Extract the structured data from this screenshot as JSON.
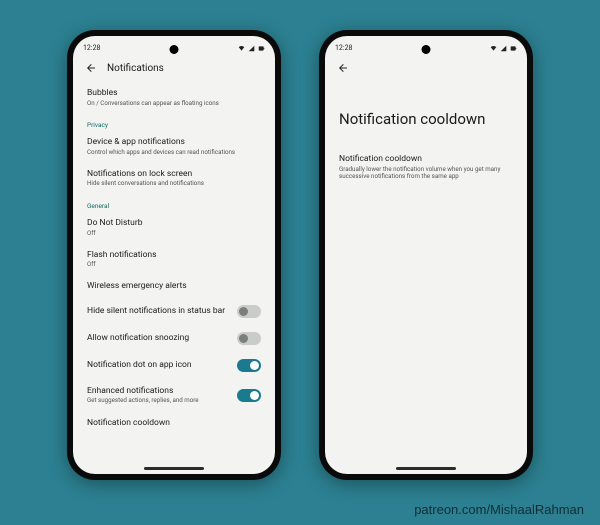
{
  "statusbar": {
    "time": "12:28"
  },
  "phone1": {
    "header_title": "Notifications",
    "bubbles": {
      "title": "Bubbles",
      "sub": "On / Conversations can appear as floating icons"
    },
    "section_privacy": "Privacy",
    "device_app": {
      "title": "Device & app notifications",
      "sub": "Control which apps and devices can read notifications"
    },
    "lock_screen": {
      "title": "Notifications on lock screen",
      "sub": "Hide silent conversations and notifications"
    },
    "section_general": "General",
    "dnd": {
      "title": "Do Not Disturb",
      "sub": "Off"
    },
    "flash": {
      "title": "Flash notifications",
      "sub": "Off"
    },
    "emergency": {
      "title": "Wireless emergency alerts"
    },
    "hide_silent": {
      "title": "Hide silent notifications in status bar"
    },
    "snoozing": {
      "title": "Allow notification snoozing"
    },
    "dot": {
      "title": "Notification dot on app icon"
    },
    "enhanced": {
      "title": "Enhanced notifications",
      "sub": "Get suggested actions, replies, and more"
    },
    "cooldown": {
      "title": "Notification cooldown"
    }
  },
  "phone2": {
    "big_title": "Notification cooldown",
    "item": {
      "title": "Notification cooldown",
      "sub": "Gradually lower the notification volume when you get many successive notifications from the same app"
    }
  },
  "credit": "patreon.com/MishaalRahman",
  "colors": {
    "accent": "#1a7b8f",
    "bg": "#2c8091"
  }
}
